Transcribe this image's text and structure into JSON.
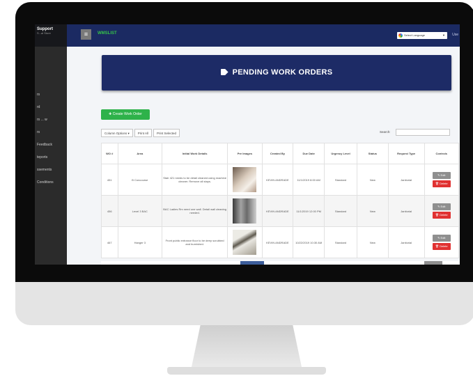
{
  "sidebar": {
    "title": "Support",
    "subtitle": "S...al Store",
    "items": [
      "rs",
      "rd",
      "rs ... w",
      "rs",
      "Feedback",
      "teports",
      "ssements",
      "Conditions"
    ]
  },
  "topbar": {
    "menu_icon": "hamburger-icon",
    "brand": "WMSLIST",
    "language_label": "Select Language",
    "user_cut": "Use"
  },
  "banner": {
    "icon": "tag-icon",
    "title": "PENDING WORK ORDERS"
  },
  "toolbar": {
    "create_label": "✚ Create Work Order",
    "column_options_label": "Column Options ▾",
    "print_all_label": "Print All",
    "print_selected_label": "Print Selected",
    "search_label": "Search:",
    "search_value": ""
  },
  "table": {
    "headers": [
      "WO #",
      "Area",
      "Initial Work Details",
      "Pre Images",
      "Created By",
      "Due Date",
      "Urgency Level",
      "Status",
      "Request Type",
      "Controls"
    ],
    "rows": [
      {
        "wo": "451",
        "area": "B Concourse",
        "details": "Stair 421 needs to be detail cleaned using machine cleaner. Remove all stays.",
        "photo": "ph1",
        "created_by": "KEVIN ANDRADE",
        "due": "11/1/2019 8:00 AM",
        "urgency": "Standard",
        "status": "New",
        "type": "Janitorial"
      },
      {
        "wo": "456",
        "area": "Level 3 BAC",
        "details": "BAC Ladies Rm need one wall. Detail wall cleaning needed.",
        "photo": "ph2",
        "created_by": "KEVIN ANDRADE",
        "due": "11/1/2019 12:00 PM",
        "urgency": "Standard",
        "status": "New",
        "type": "Janitorial"
      },
      {
        "wo": "467",
        "area": "Hanger 3",
        "details": "Front public entrance floor to be deep scrubbed and burnished.",
        "photo": "ph3",
        "created_by": "KEVIN ANDRADE",
        "due": "10/22/2019 10:30 AM",
        "urgency": "Standard",
        "status": "New",
        "type": "Janitorial"
      }
    ],
    "edit_label": "✎ Edit",
    "delete_label": "🗑 Delete"
  },
  "colors": {
    "topbar": "#1b2a62",
    "banner": "#1d2b66",
    "create_button": "#2eb24a",
    "delete_button": "#e03131",
    "urgency_standard": "#f2a21e"
  }
}
